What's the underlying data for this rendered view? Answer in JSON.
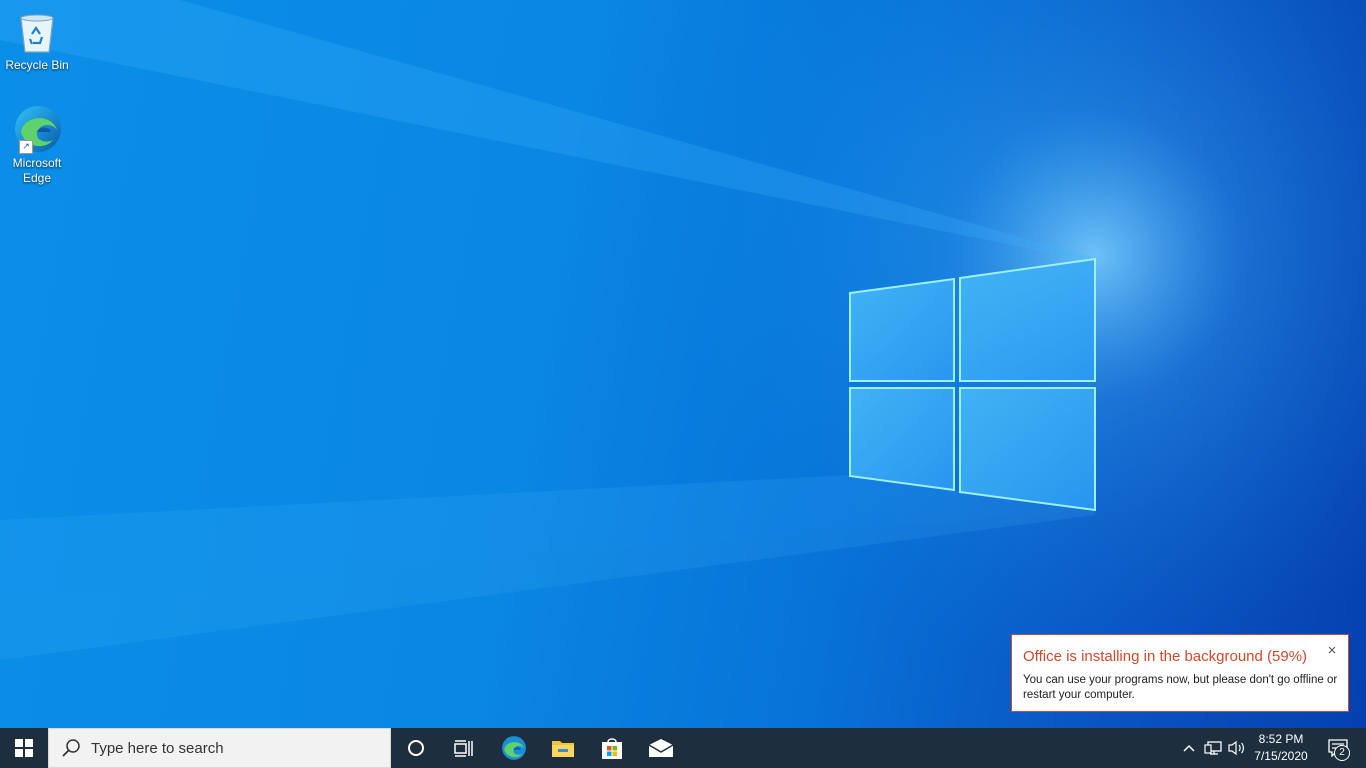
{
  "desktop": {
    "icons": [
      {
        "label": "Recycle Bin",
        "icon": "recycle-bin-icon"
      },
      {
        "label": "Microsoft\nEdge",
        "icon": "edge-icon"
      }
    ]
  },
  "toast": {
    "title": "Office is installing in the background (59%)",
    "body": "You can use your programs now, but please don't go offline or restart your computer.",
    "close_glyph": "×",
    "progress_percent": 59,
    "accent_color": "#d04a2a"
  },
  "taskbar": {
    "search_placeholder": "Type here to search",
    "pinned": [
      "cortana-icon",
      "task-view-icon",
      "edge-icon",
      "file-explorer-icon",
      "store-icon",
      "mail-icon"
    ],
    "tray": {
      "icons": [
        "chevron-up-icon",
        "network-icon",
        "volume-icon"
      ],
      "time": "8:52 PM",
      "date": "7/15/2020",
      "notification_count": "2"
    },
    "background_color": "#1d2e3e"
  }
}
